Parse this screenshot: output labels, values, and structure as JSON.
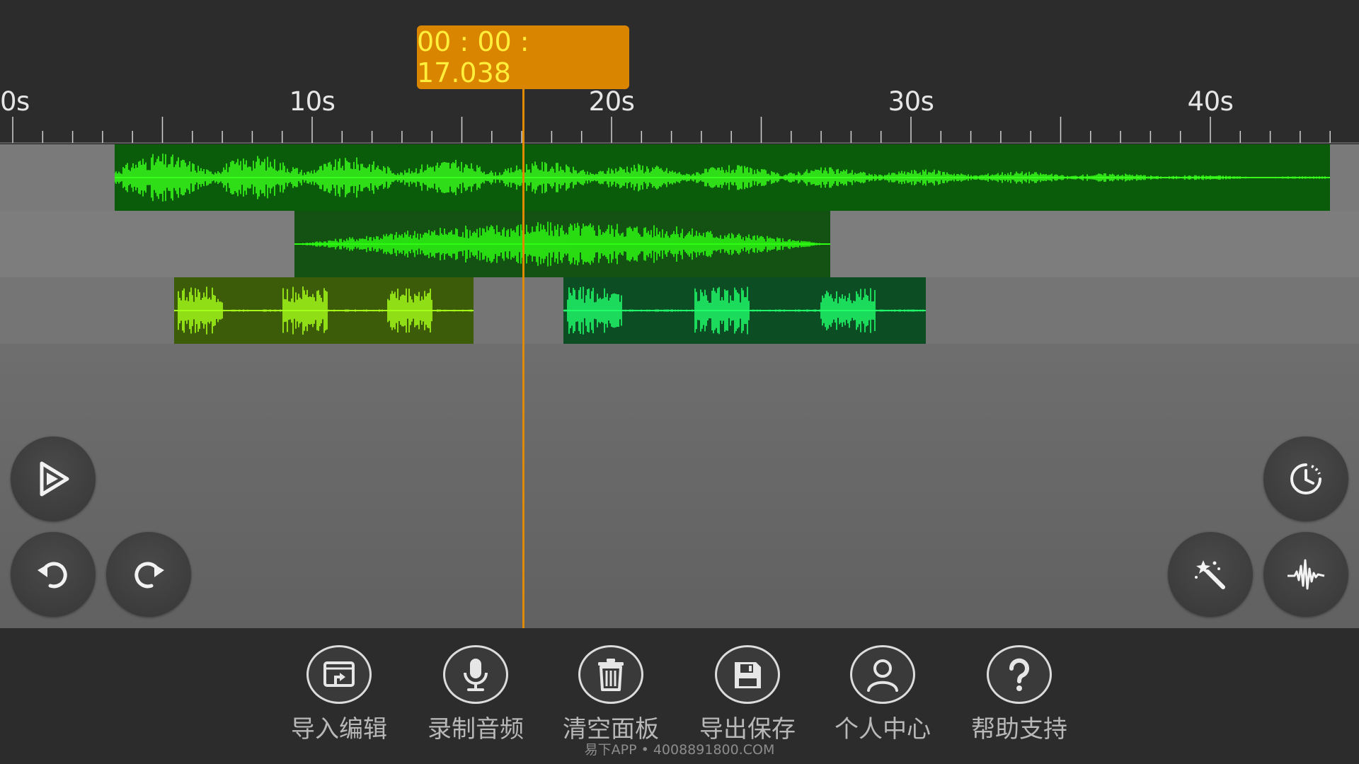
{
  "playhead": {
    "time": "00 : 00 : 17.038"
  },
  "ruler": {
    "labels": [
      "0s",
      "10s",
      "20s",
      "30s",
      "40s"
    ],
    "seconds_visible_end": 45
  },
  "tracks": [
    {
      "name": "track-1",
      "clips": [
        {
          "start_s": 3.4,
          "end_s": 44.0,
          "color": "#0a5c0a",
          "wave": "#39ff1c"
        }
      ]
    },
    {
      "name": "track-2",
      "clips": [
        {
          "start_s": 9.4,
          "end_s": 27.3,
          "color": "#145214",
          "wave": "#2dff12"
        }
      ]
    },
    {
      "name": "track-3",
      "clips": [
        {
          "start_s": 5.4,
          "end_s": 15.4,
          "color": "#3d5c0a",
          "wave": "#a6ff1a"
        },
        {
          "start_s": 18.4,
          "end_s": 30.5,
          "color": "#0d4d24",
          "wave": "#20ff6a"
        }
      ]
    }
  ],
  "controls": {
    "play_icon": "play-icon",
    "undo_icon": "undo-icon",
    "redo_icon": "redo-icon",
    "timer_icon": "timer-icon",
    "effects_icon": "magic-wand-icon",
    "waveform_icon": "waveform-icon"
  },
  "toolbar": {
    "items": [
      {
        "icon": "import-icon",
        "label": "导入编辑"
      },
      {
        "icon": "microphone-icon",
        "label": "录制音频"
      },
      {
        "icon": "trash-icon",
        "label": "清空面板"
      },
      {
        "icon": "save-icon",
        "label": "导出保存"
      },
      {
        "icon": "user-icon",
        "label": "个人中心"
      },
      {
        "icon": "help-icon",
        "label": "帮助支持"
      }
    ]
  },
  "watermark": "易下APP • 4008891800.COM",
  "colors": {
    "playhead": "#e08a00",
    "playhead_text": "#ffee3a",
    "background": "#2c2c2c"
  }
}
